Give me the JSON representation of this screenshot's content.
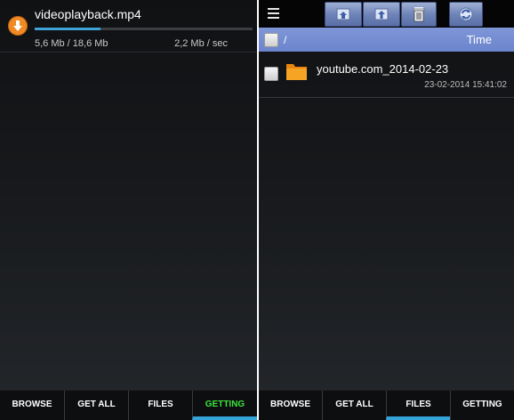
{
  "left": {
    "download": {
      "icon": "download-arrow-icon",
      "filename": "videoplayback.mp4",
      "size": "5,6 Mb / 18,6 Mb",
      "speed": "2,2 Mb / sec",
      "progress": 0.3
    },
    "tabs": [
      {
        "label": "BROWSE"
      },
      {
        "label": "GET ALL"
      },
      {
        "label": "FILES"
      },
      {
        "label": "GETTING"
      }
    ],
    "active_tab": "GETTING",
    "active_color": "#3ce23c"
  },
  "right": {
    "toolbar": {
      "icons": [
        "menu-icon",
        "home-icon",
        "folder-up-icon",
        "trash-icon",
        "refresh-icon"
      ]
    },
    "path": "/",
    "sort_label": "Time",
    "files": [
      {
        "name": "youtube.com_2014-02-23",
        "date": "23-02-2014 15:41:02",
        "icon": "folder-icon"
      }
    ],
    "tabs": [
      {
        "label": "BROWSE"
      },
      {
        "label": "GET ALL"
      },
      {
        "label": "FILES"
      },
      {
        "label": "GETTING"
      }
    ],
    "active_tab": "FILES"
  },
  "colors": {
    "accent": "#33a3d8",
    "progress": "#3ea3d6",
    "download_icon": "#f08a24",
    "path_bar": "#6b84cc"
  }
}
